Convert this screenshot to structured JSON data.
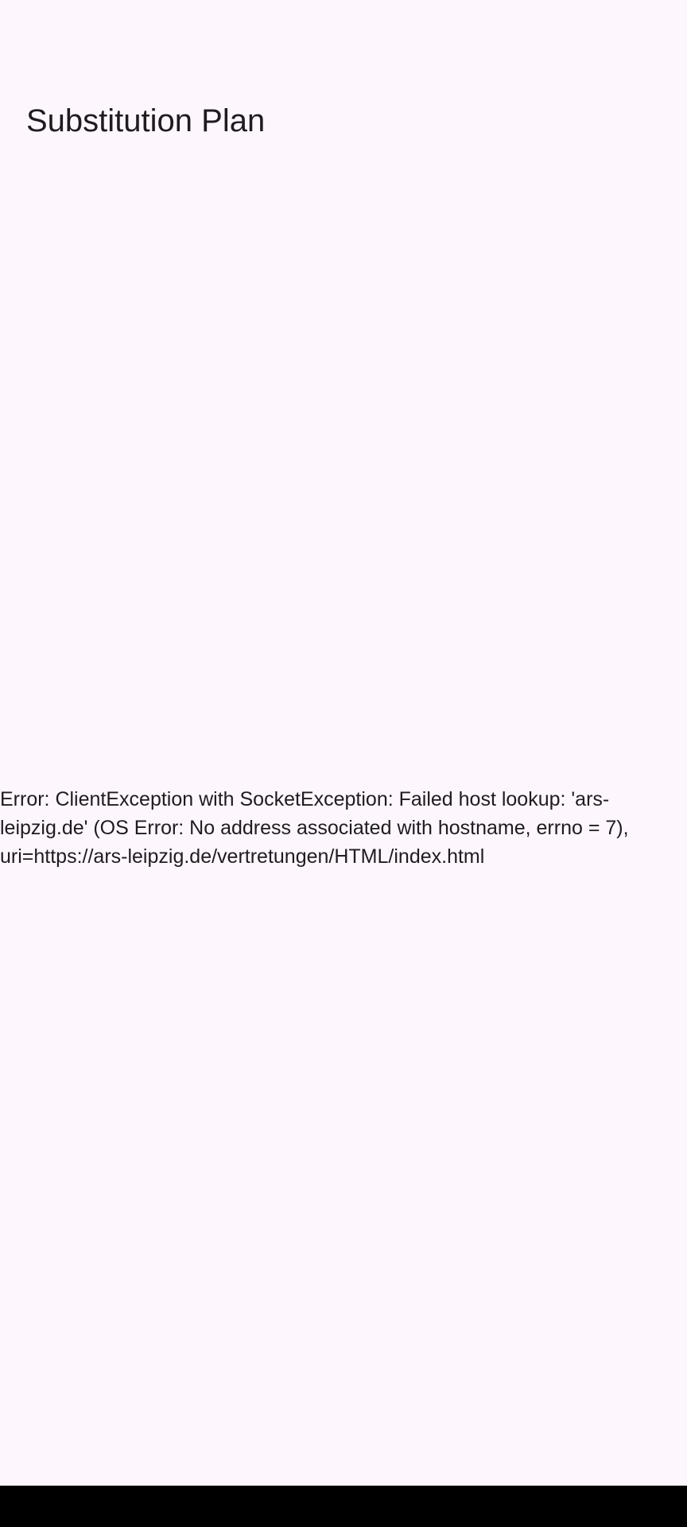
{
  "app_bar": {
    "title": "Substitution Plan"
  },
  "main": {
    "error_message": "Error: ClientException with SocketException: Failed host lookup: 'ars-leipzig.de' (OS Error: No address associated with hostname, errno = 7), uri=https://ars-leipzig.de/vertretungen/HTML/index.html"
  },
  "colors": {
    "background": "#fdf7fd",
    "text": "#1f1b20",
    "system_nav_bar": "#000000"
  }
}
